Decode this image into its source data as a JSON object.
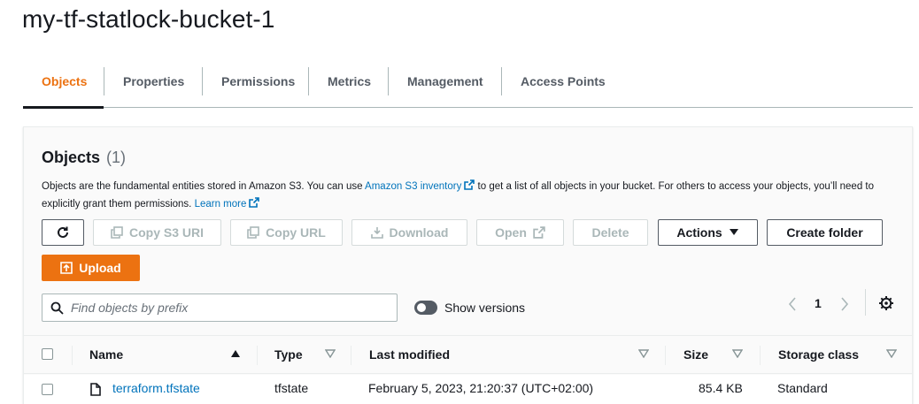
{
  "page": {
    "title": "my-tf-statlock-bucket-1"
  },
  "tabs": [
    {
      "label": "Objects",
      "active": true
    },
    {
      "label": "Properties"
    },
    {
      "label": "Permissions"
    },
    {
      "label": "Metrics"
    },
    {
      "label": "Management"
    },
    {
      "label": "Access Points"
    }
  ],
  "objects_panel": {
    "title": "Objects",
    "count": "(1)",
    "description": {
      "part1": "Objects are the fundamental entities stored in Amazon S3. You can use ",
      "inventory_link": "Amazon S3 inventory",
      "part2": " to get a list of all objects in your bucket. For others to access your objects, you’ll need to explicitly grant them permissions. ",
      "learn_more": "Learn more"
    },
    "toolbar": {
      "copy_s3_uri": "Copy S3 URI",
      "copy_url": "Copy URL",
      "download": "Download",
      "open": "Open",
      "delete": "Delete",
      "actions": "Actions",
      "create_folder": "Create folder",
      "upload": "Upload"
    },
    "search": {
      "placeholder": "Find objects by prefix",
      "value": ""
    },
    "show_versions": {
      "label": "Show versions",
      "on": false
    },
    "pagination": {
      "current_page": "1"
    },
    "table": {
      "columns": [
        "Name",
        "Type",
        "Last modified",
        "Size",
        "Storage class"
      ],
      "rows": [
        {
          "name": "terraform.tfstate",
          "type": "tfstate",
          "last_modified": "February 5, 2023, 21:20:37 (UTC+02:00)",
          "size": "85.4 KB",
          "storage_class": "Standard"
        }
      ]
    }
  },
  "colors": {
    "accent": "#ec7211",
    "link": "#0073bb",
    "text": "#16191f",
    "muted": "#545b64",
    "disabled": "#aab7b8"
  },
  "icons": [
    "refresh-icon",
    "copy-icon",
    "download-icon",
    "external-link-icon",
    "caret-down-icon",
    "upload-icon",
    "search-icon",
    "chevron-left-icon",
    "chevron-right-icon",
    "gear-icon",
    "sort-ascending-icon",
    "sort-descending-icon",
    "file-icon"
  ]
}
